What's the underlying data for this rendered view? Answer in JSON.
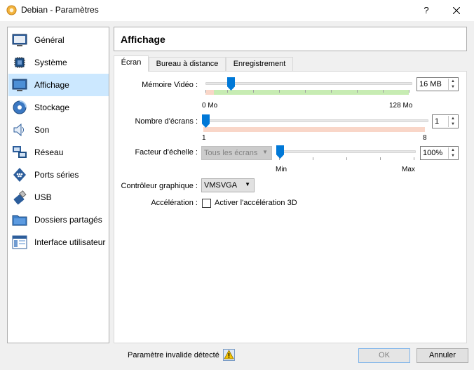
{
  "window": {
    "title": "Debian - Paramètres",
    "help_glyph": "?",
    "close_glyph": "✕"
  },
  "sidebar": {
    "items": [
      {
        "label": "Général",
        "icon": "general-icon",
        "selected": false
      },
      {
        "label": "Système",
        "icon": "system-icon",
        "selected": false
      },
      {
        "label": "Affichage",
        "icon": "display-icon",
        "selected": true
      },
      {
        "label": "Stockage",
        "icon": "storage-icon",
        "selected": false
      },
      {
        "label": "Son",
        "icon": "audio-icon",
        "selected": false
      },
      {
        "label": "Réseau",
        "icon": "network-icon",
        "selected": false
      },
      {
        "label": "Ports séries",
        "icon": "serial-ports-icon",
        "selected": false
      },
      {
        "label": "USB",
        "icon": "usb-icon",
        "selected": false
      },
      {
        "label": "Dossiers partagés",
        "icon": "shared-folders-icon",
        "selected": false
      },
      {
        "label": "Interface utilisateur",
        "icon": "user-interface-icon",
        "selected": false
      }
    ]
  },
  "page": {
    "title": "Affichage"
  },
  "tabs": [
    {
      "label": "Écran",
      "active": true
    },
    {
      "label": "Bureau à distance",
      "active": false
    },
    {
      "label": "Enregistrement",
      "active": false
    }
  ],
  "screen": {
    "video_memory": {
      "label": "Mémoire Vidéo :",
      "value": "16 MB",
      "min_label": "0 Mo",
      "max_label": "128 Mo"
    },
    "monitor_count": {
      "label": "Nombre d'écrans :",
      "value": "1",
      "min_label": "1",
      "max_label": "8"
    },
    "scale_factor": {
      "label": "Facteur d'échelle :",
      "combo_value": "Tous les écrans",
      "value": "100%",
      "min_label": "Min",
      "max_label": "Max"
    },
    "graphics_controller": {
      "label": "Contrôleur graphique :",
      "value": "VMSVGA"
    },
    "acceleration": {
      "label": "Accélération :",
      "checkbox_label": "Activer l'accélération 3D",
      "checked": false
    }
  },
  "footer": {
    "status_text": "Paramètre invalide détecté",
    "ok_label": "OK",
    "cancel_label": "Annuler"
  },
  "colors": {
    "accent": "#0078d7",
    "selected_bg": "#cce8ff",
    "range_ok": "#c7ecb3",
    "range_bad": "#f9d6c8"
  }
}
